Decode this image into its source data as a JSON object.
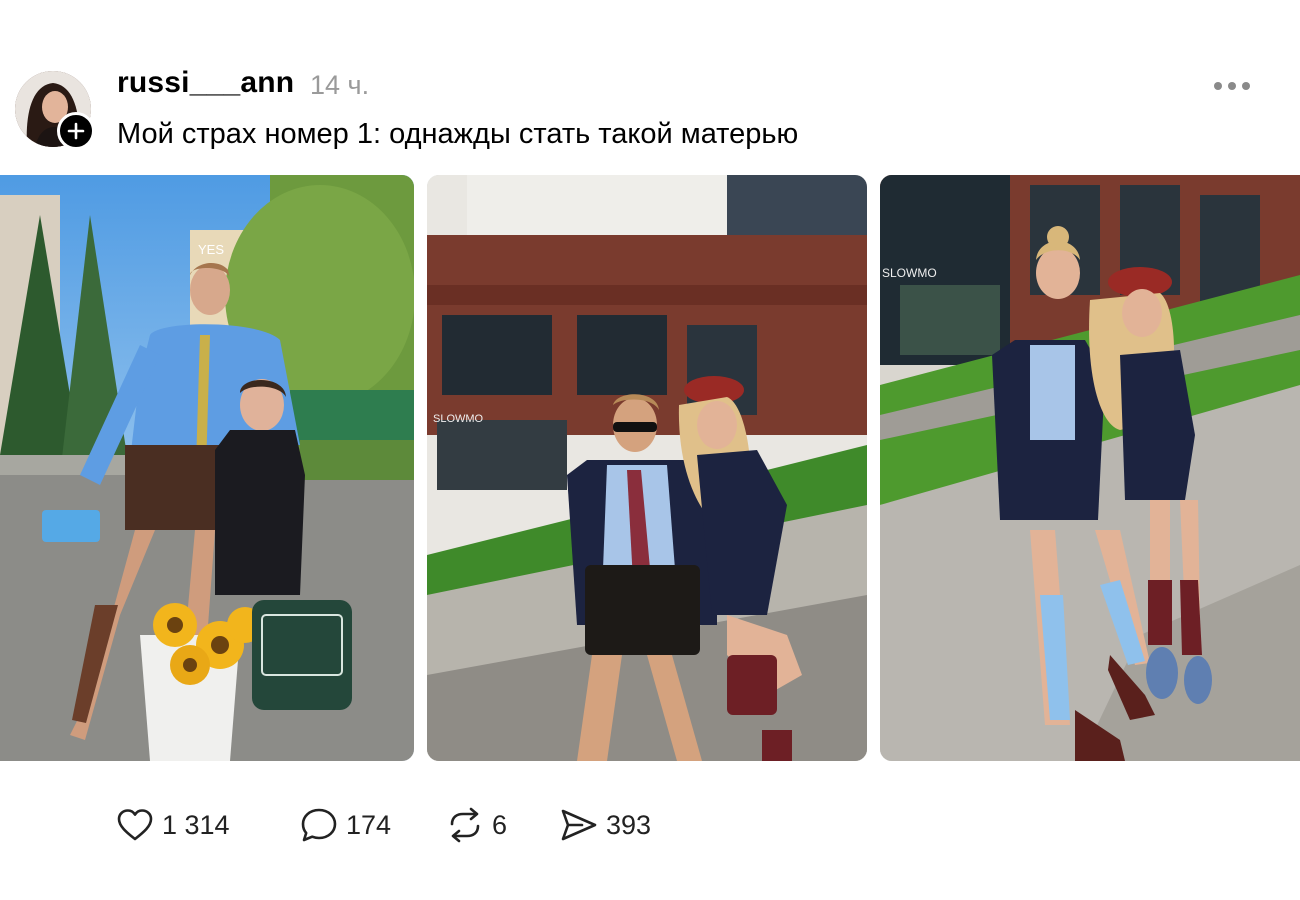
{
  "post": {
    "username": "russi___ann",
    "time": "14 ч.",
    "caption": "Мой страх номер 1: однажды стать такой матерью"
  },
  "photos": [
    {
      "sign": "YES"
    },
    {
      "sign": "SLOWMO"
    },
    {
      "sign": "SLOWMO"
    }
  ],
  "actions": {
    "likes": "1 314",
    "comments": "174",
    "reposts": "6",
    "shares": "393"
  },
  "icons": {
    "follow": "plus-icon",
    "more": "more-dots-icon",
    "like": "heart-icon",
    "comment": "comment-bubble-icon",
    "repost": "repost-icon",
    "share": "send-icon"
  }
}
